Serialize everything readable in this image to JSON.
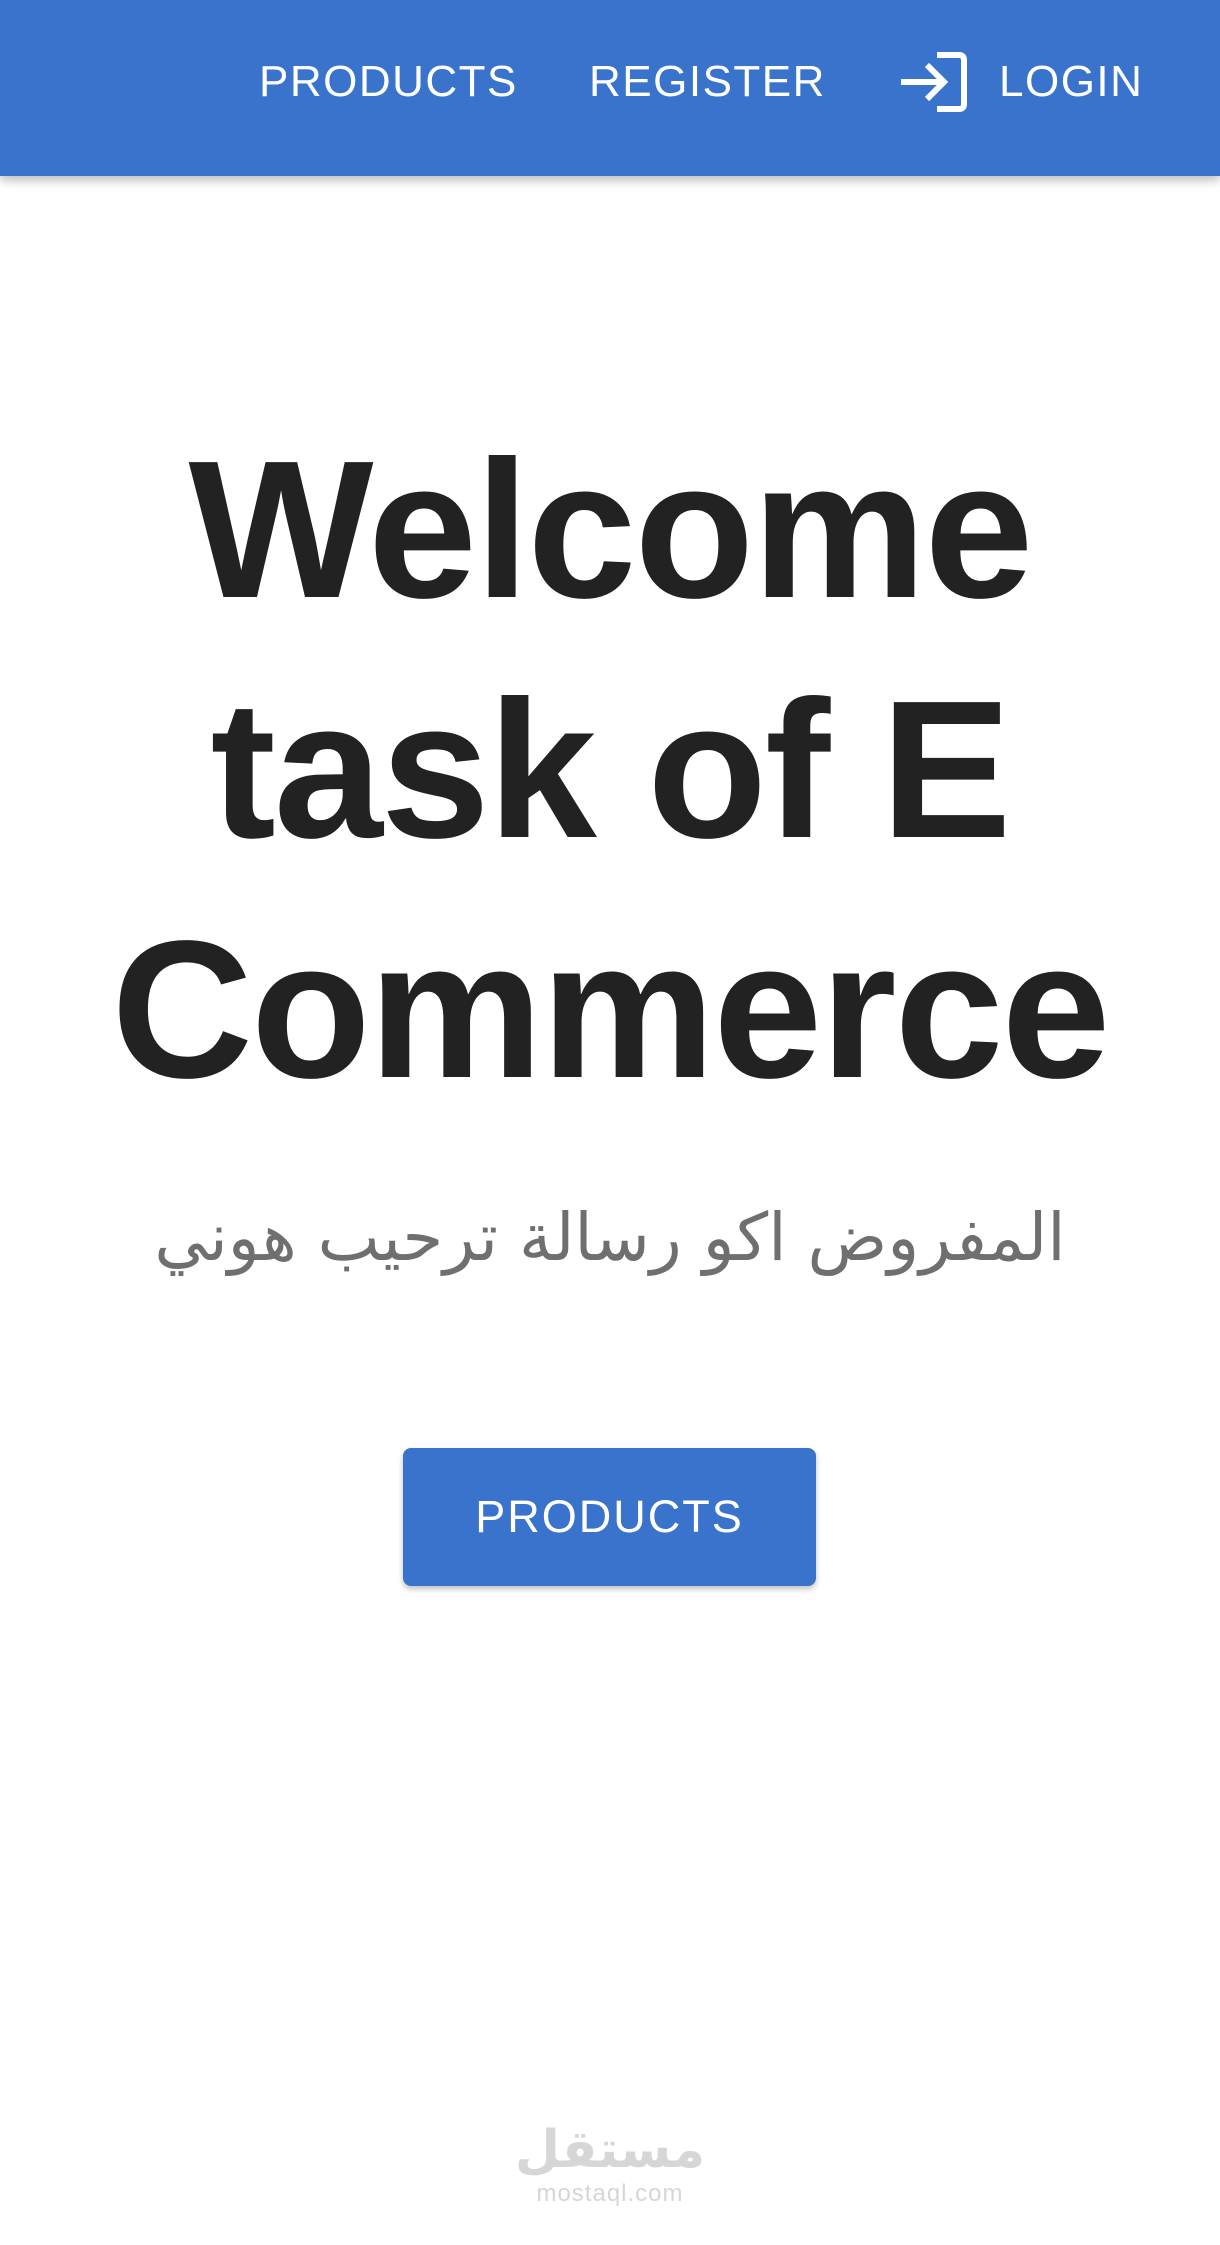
{
  "navbar": {
    "items": [
      {
        "label": "PRODUCTS"
      },
      {
        "label": "REGISTER"
      },
      {
        "label": "LOGIN",
        "icon": "login-icon"
      }
    ]
  },
  "hero": {
    "title": "Welcome task of E Commerce",
    "subtitle": "المفروض اكو رسالة ترحيب هوني",
    "cta_label": "PRODUCTS"
  },
  "watermark": {
    "arabic": "مستقل",
    "latin": "mostaql.com"
  },
  "colors": {
    "primary": "#3a73cb",
    "title": "#222222",
    "subtitle": "#6f6f6f",
    "background": "#ffffff"
  }
}
